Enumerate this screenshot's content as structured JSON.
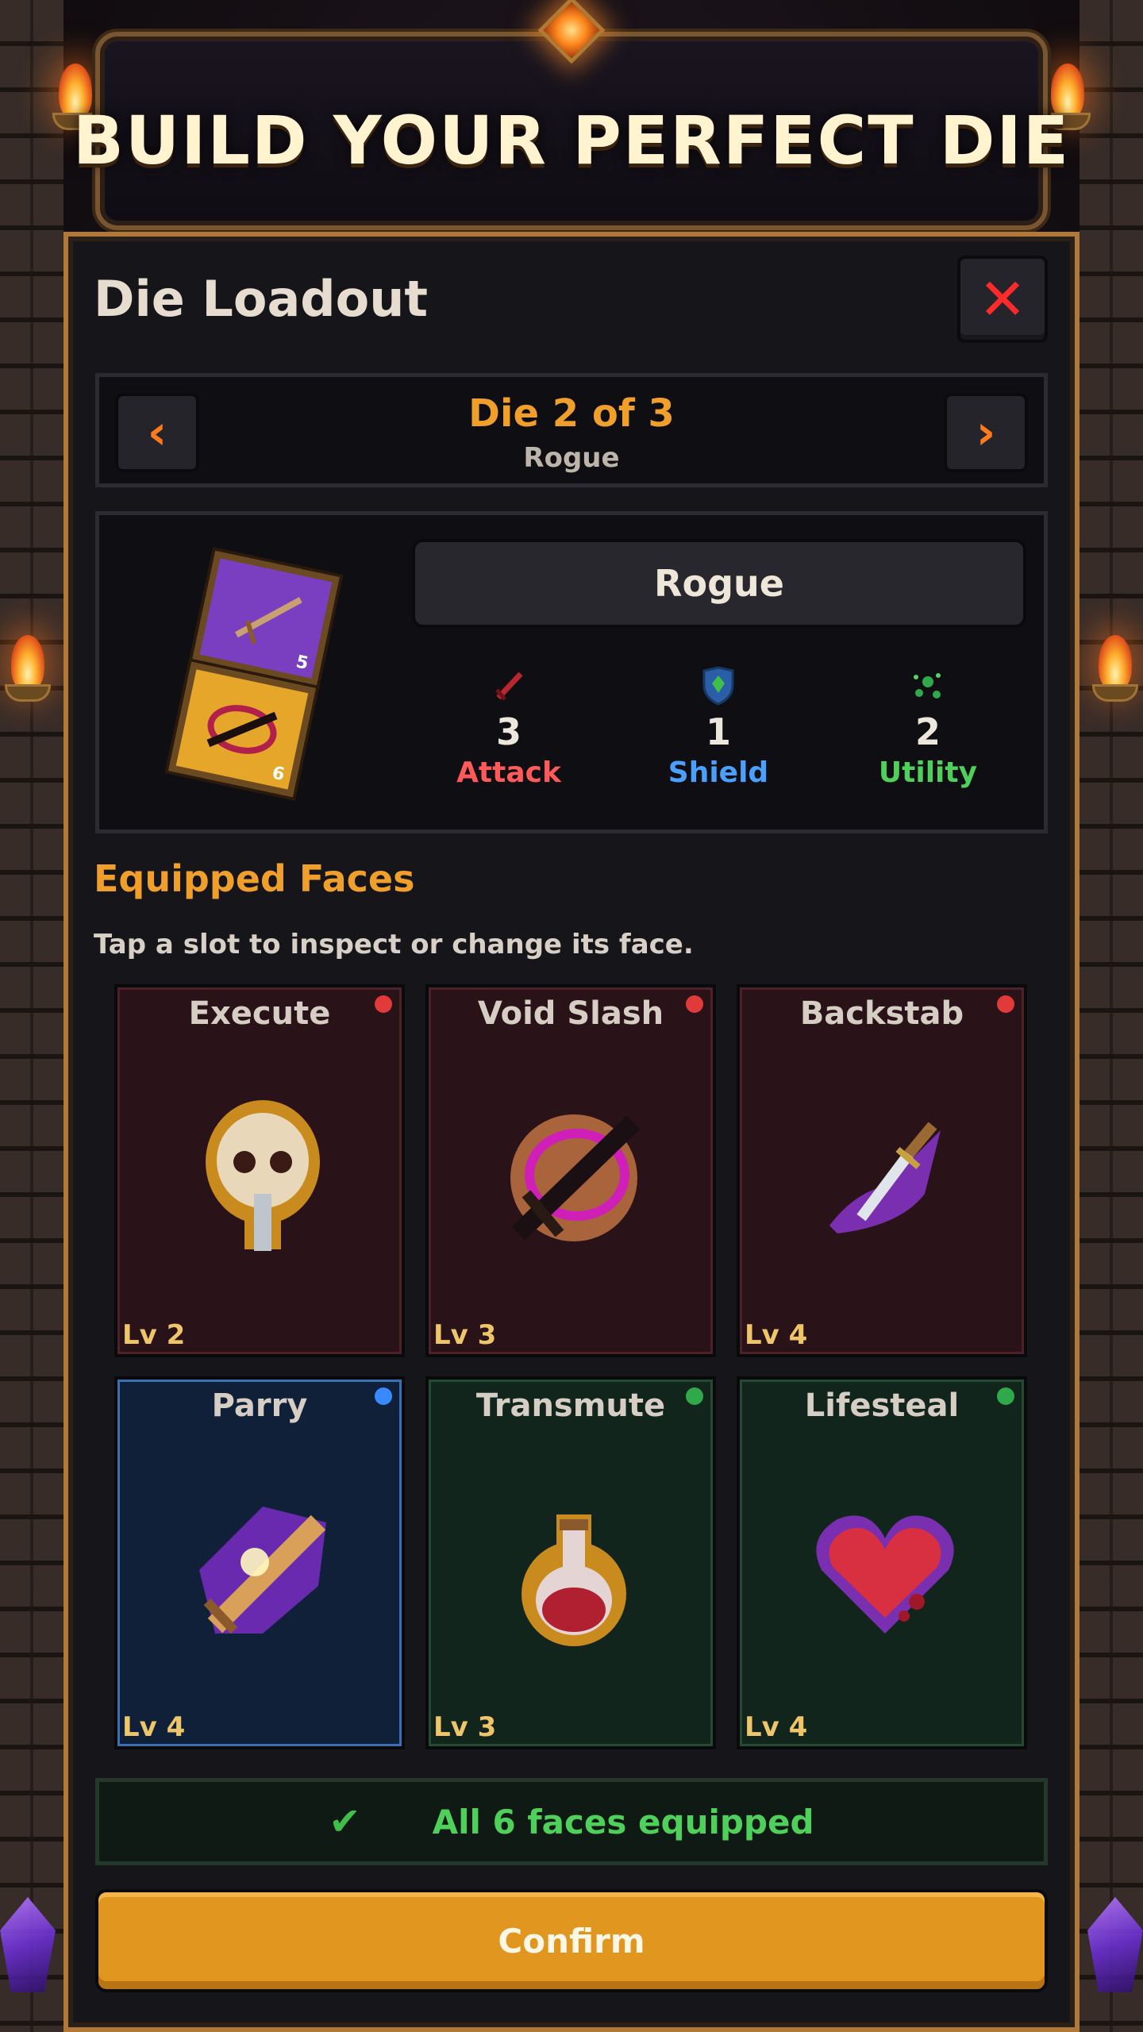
{
  "banner": {
    "title": "BUILD YOUR PERFECT DIE"
  },
  "panel": {
    "title": "Die Loadout",
    "close_icon": "close-icon"
  },
  "selector": {
    "die_label": "Die 2 of 3",
    "class_name": "Rogue"
  },
  "die_info": {
    "class_name": "Rogue",
    "die_faces_shown": [
      "5",
      "6"
    ],
    "stats": [
      {
        "label": "Attack",
        "value": "3",
        "icon": "sword-icon",
        "color": "#ff5a5a"
      },
      {
        "label": "Shield",
        "value": "1",
        "icon": "shield-icon",
        "color": "#4aa0ff"
      },
      {
        "label": "Utility",
        "value": "2",
        "icon": "sparkle-icon",
        "color": "#4fd05a"
      }
    ]
  },
  "faces_section": {
    "title": "Equipped Faces",
    "hint": "Tap a slot to inspect or change its face."
  },
  "faces": [
    {
      "name": "Execute",
      "level": "Lv 2",
      "type": "attack",
      "dot_color": "#e03a3a",
      "icon": "skull-icon"
    },
    {
      "name": "Void Slash",
      "level": "Lv 3",
      "type": "attack",
      "dot_color": "#e03a3a",
      "icon": "void-sword-icon"
    },
    {
      "name": "Backstab",
      "level": "Lv 4",
      "type": "attack",
      "dot_color": "#e03a3a",
      "icon": "dagger-icon"
    },
    {
      "name": "Parry",
      "level": "Lv 4",
      "type": "shield",
      "dot_color": "#3a8aff",
      "icon": "parry-sword-icon"
    },
    {
      "name": "Transmute",
      "level": "Lv 3",
      "type": "utility",
      "dot_color": "#2fa94a",
      "icon": "potion-icon"
    },
    {
      "name": "Lifesteal",
      "level": "Lv 4",
      "type": "utility",
      "dot_color": "#2fa94a",
      "icon": "heart-icon"
    }
  ],
  "status": {
    "text": "All 6 faces equipped",
    "icon": "check-icon"
  },
  "confirm": {
    "label": "Confirm"
  },
  "colors": {
    "accent_orange": "#f0a02a",
    "panel_border": "#b0793a",
    "confirm_bg": "#e0961f"
  }
}
